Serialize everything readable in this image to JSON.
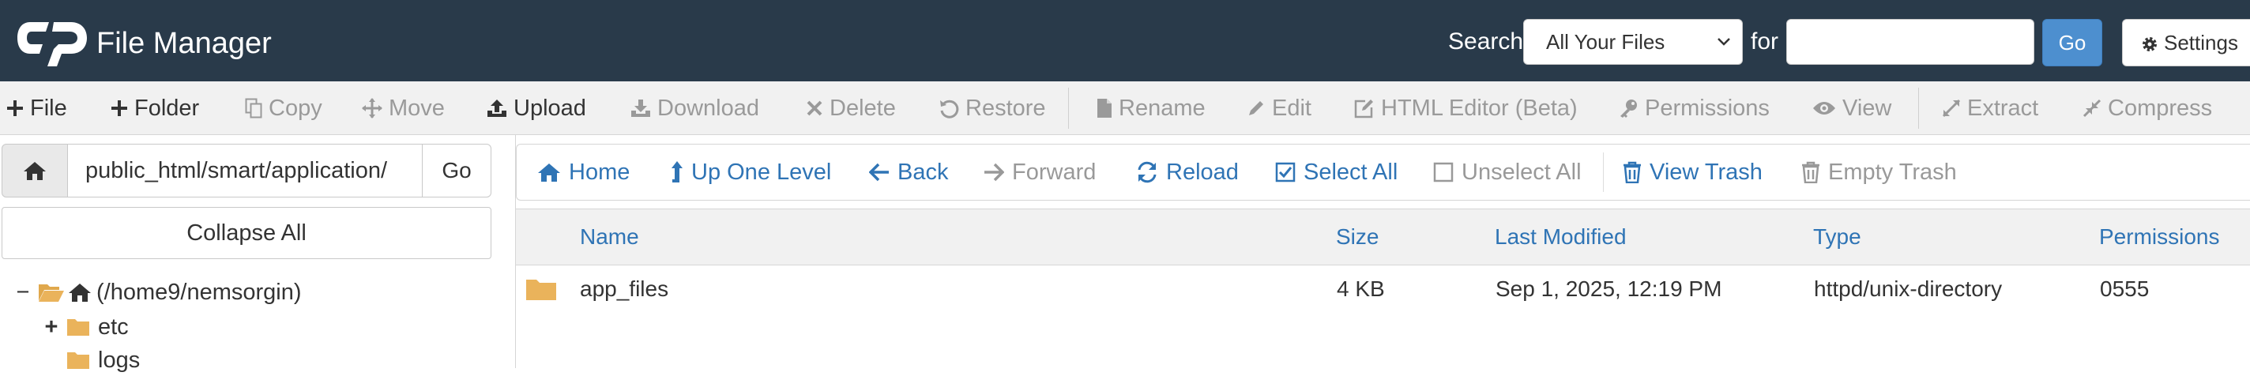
{
  "header": {
    "app_title": "File Manager",
    "search_label": "Search",
    "search_scope": "All Your Files",
    "for_label": "for",
    "search_value": "",
    "go_label": "Go",
    "settings_label": "Settings",
    "bg_color": "#293a4a",
    "accent_color": "#4d8fcf"
  },
  "toolbar": {
    "items": [
      {
        "label": "File",
        "icon": "plus-icon",
        "enabled": true
      },
      {
        "label": "Folder",
        "icon": "plus-icon",
        "enabled": true
      },
      {
        "label": "Copy",
        "icon": "copy-icon",
        "enabled": false
      },
      {
        "label": "Move",
        "icon": "move-icon",
        "enabled": false
      },
      {
        "label": "Upload",
        "icon": "upload-icon",
        "enabled": true
      },
      {
        "label": "Download",
        "icon": "download-icon",
        "enabled": false
      },
      {
        "label": "Delete",
        "icon": "close-icon",
        "enabled": false
      },
      {
        "label": "Restore",
        "icon": "undo-icon",
        "enabled": false
      },
      {
        "label": "Rename",
        "icon": "file-icon",
        "enabled": false
      },
      {
        "label": "Edit",
        "icon": "pencil-icon",
        "enabled": false
      },
      {
        "label": "HTML Editor (Beta)",
        "icon": "edit-square-icon",
        "enabled": false
      },
      {
        "label": "Permissions",
        "icon": "key-icon",
        "enabled": false
      },
      {
        "label": "View",
        "icon": "eye-icon",
        "enabled": false
      },
      {
        "label": "Extract",
        "icon": "expand-icon",
        "enabled": false
      },
      {
        "label": "Compress",
        "icon": "compress-icon",
        "enabled": false
      }
    ]
  },
  "sidebar": {
    "path_value": "public_html/smart/application/",
    "go_label": "Go",
    "collapse_label": "Collapse All",
    "tree": [
      {
        "toggle": "−",
        "label": "(/home9/nemsorgin)",
        "home": true
      },
      {
        "toggle": "+",
        "label": "etc",
        "home": false
      },
      {
        "toggle": "",
        "label": "logs",
        "home": false
      }
    ]
  },
  "navbar": {
    "items": [
      {
        "label": "Home",
        "icon": "home-icon",
        "enabled": true
      },
      {
        "label": "Up One Level",
        "icon": "level-up-icon",
        "enabled": true
      },
      {
        "label": "Back",
        "icon": "arrow-left-icon",
        "enabled": true
      },
      {
        "label": "Forward",
        "icon": "arrow-right-icon",
        "enabled": false
      },
      {
        "label": "Reload",
        "icon": "refresh-icon",
        "enabled": true
      },
      {
        "label": "Select All",
        "icon": "checked-box-icon",
        "enabled": true
      },
      {
        "label": "Unselect All",
        "icon": "empty-box-icon",
        "enabled": false
      },
      {
        "label": "View Trash",
        "icon": "trash-icon",
        "enabled": true
      },
      {
        "label": "Empty Trash",
        "icon": "trash-icon",
        "enabled": false
      }
    ]
  },
  "table": {
    "columns": [
      "Name",
      "Size",
      "Last Modified",
      "Type",
      "Permissions"
    ],
    "rows": [
      {
        "icon": "folder-icon",
        "name": "app_files",
        "size": "4 KB",
        "modified": "Sep 1, 2025, 12:19 PM",
        "type": "httpd/unix-directory",
        "permissions": "0555"
      }
    ]
  }
}
